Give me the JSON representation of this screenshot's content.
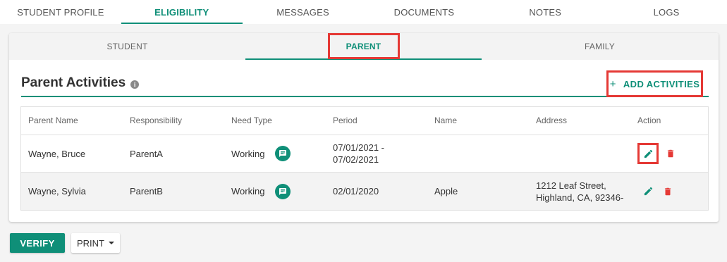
{
  "top_tabs": [
    "STUDENT PROFILE",
    "ELIGIBILITY",
    "MESSAGES",
    "DOCUMENTS",
    "NOTES",
    "LOGS"
  ],
  "sub_tabs": [
    "STUDENT",
    "PARENT",
    "FAMILY"
  ],
  "section": {
    "title": "Parent Activities",
    "info_glyph": "i",
    "add_plus": "+",
    "add_label": "ADD ACTIVITIES"
  },
  "table": {
    "columns": [
      "Parent Name",
      "Responsibility",
      "Need Type",
      "Period",
      "Name",
      "Address",
      "Action"
    ],
    "rows": [
      {
        "parent_name": "Wayne, Bruce",
        "responsibility": "ParentA",
        "need_type": "Working",
        "period_1": "07/01/2021 -",
        "period_2": "07/02/2021",
        "name": "",
        "address_1": "",
        "address_2": ""
      },
      {
        "parent_name": "Wayne, Sylvia",
        "responsibility": "ParentB",
        "need_type": "Working",
        "period_1": "02/01/2020",
        "period_2": "",
        "name": "Apple",
        "address_1": "1212 Leaf Street,",
        "address_2": "Highland, CA, 92346-"
      }
    ]
  },
  "buttons": {
    "verify": "VERIFY",
    "print": "PRINT"
  },
  "colors": {
    "accent": "#0f8f78",
    "highlight": "#e53935",
    "delete": "#e53935"
  },
  "icons": {
    "info": "info-icon",
    "chat": "chat-icon",
    "edit": "pencil-icon",
    "delete": "trash-icon",
    "dropdown": "caret-down-icon"
  }
}
